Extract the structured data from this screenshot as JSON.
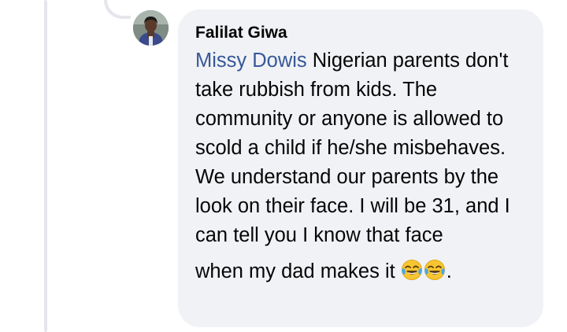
{
  "comment": {
    "author": "Falilat Giwa",
    "mention": "Missy Dowis",
    "text_line_1": " Nigerian parents don't take rubbish from kids. The community or anyone is allowed to scold a child if he/she misbehaves.",
    "text_line_2": "We understand our parents by the look on their face. I will be 31, and I can tell you I know that face",
    "text_line_3": "when my dad makes it",
    "trailing": ".",
    "emoji": [
      "face-with-tears-of-joy-icon",
      "face-with-tears-of-joy-icon"
    ]
  },
  "colors": {
    "bubble": "#f0f2f5",
    "mention": "#385898",
    "text": "#050505",
    "thread_line": "#e4e6eb"
  }
}
